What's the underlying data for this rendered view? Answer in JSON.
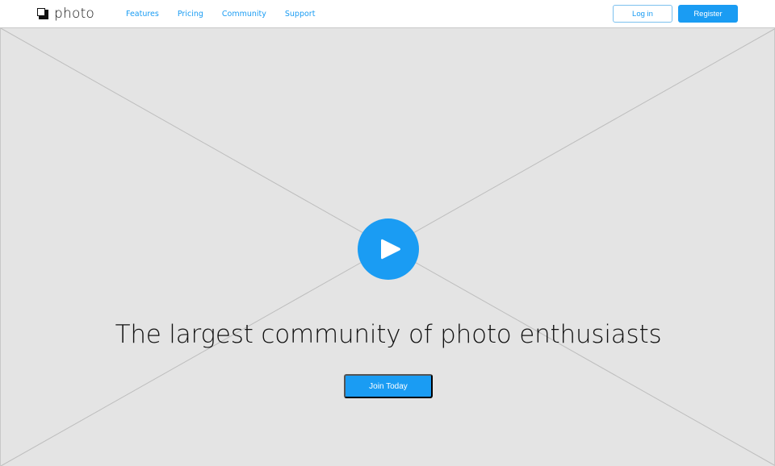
{
  "brand": {
    "name": "photo",
    "logo_icon": "square-stack-icon"
  },
  "nav": {
    "links": [
      {
        "label": "Features"
      },
      {
        "label": "Pricing"
      },
      {
        "label": "Community"
      },
      {
        "label": "Support"
      }
    ],
    "login_label": "Log in",
    "register_label": "Register"
  },
  "hero": {
    "media_placeholder": "image-placeholder",
    "play_icon": "play-icon",
    "headline": "The largest community of photo enthusiasts",
    "cta_label": "Join Today"
  },
  "colors": {
    "accent": "#1a9cf3",
    "hero_background": "#e4e4e4",
    "text": "#111111"
  }
}
